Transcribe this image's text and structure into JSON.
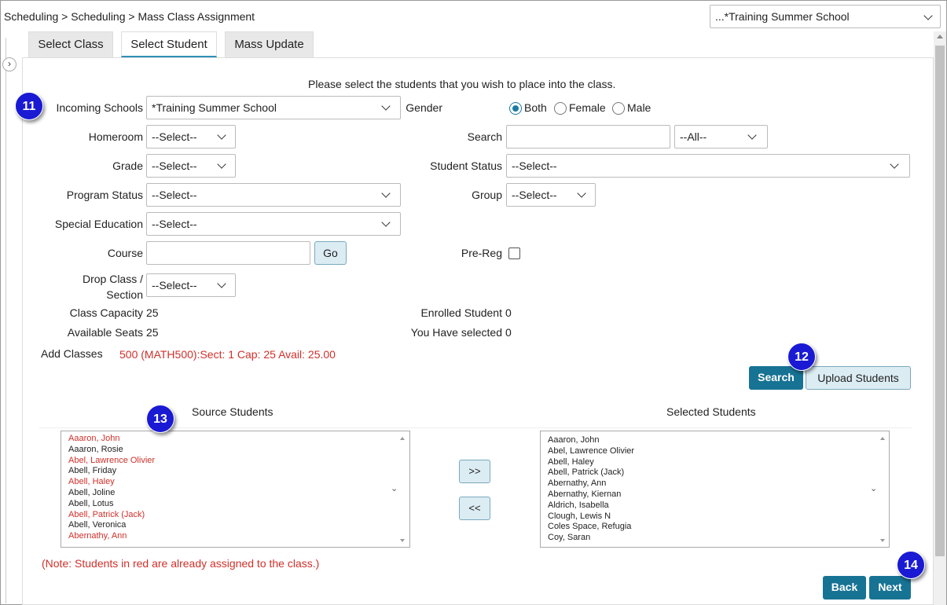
{
  "breadcrumb": "Scheduling > Scheduling > Mass Class Assignment",
  "school_selector": {
    "value": "...*Training Summer School"
  },
  "tabs": [
    {
      "label": "Select Class",
      "active": false
    },
    {
      "label": "Select Student",
      "active": true
    },
    {
      "label": "Mass Update",
      "active": false
    }
  ],
  "instructions": "Please select the students that you wish to place into the class.",
  "filters": {
    "incoming_schools": {
      "label": "Incoming Schools",
      "value": "*Training Summer School"
    },
    "homeroom": {
      "label": "Homeroom",
      "value": "--Select--"
    },
    "grade": {
      "label": "Grade",
      "value": "--Select--"
    },
    "program_status": {
      "label": "Program Status",
      "value": "--Select--"
    },
    "special_education": {
      "label": "Special Education",
      "value": "--Select--"
    },
    "course": {
      "label": "Course",
      "value": "",
      "go_label": "Go"
    },
    "drop_class": {
      "label_line1": "Drop Class /",
      "label_line2": "Section",
      "value": "--Select--"
    },
    "gender": {
      "label": "Gender",
      "options": [
        "Both",
        "Female",
        "Male"
      ],
      "selected": "Both"
    },
    "search": {
      "label": "Search",
      "value": "",
      "scope": "--All--"
    },
    "student_status": {
      "label": "Student Status",
      "value": "--Select--"
    },
    "group": {
      "label": "Group",
      "value": "--Select--"
    },
    "pre_reg": {
      "label": "Pre-Reg",
      "checked": false
    }
  },
  "stats": {
    "class_capacity_label": "Class Capacity",
    "class_capacity": "25",
    "available_seats_label": "Available Seats",
    "available_seats": "25",
    "enrolled_label": "Enrolled Student",
    "enrolled": "0",
    "selected_label": "You Have selected",
    "selected": "0"
  },
  "add_classes": {
    "label": "Add Classes",
    "value": "500 (MATH500):Sect: 1 Cap: 25 Avail: 25.00"
  },
  "actions": {
    "search_label": "Search",
    "upload_label": "Upload Students"
  },
  "source_students": {
    "title": "Source Students",
    "items": [
      {
        "name": "Aaaron, John",
        "assigned": true
      },
      {
        "name": "Aaaron, Rosie",
        "assigned": false
      },
      {
        "name": "Abel, Lawrence Olivier",
        "assigned": true
      },
      {
        "name": "Abell, Friday",
        "assigned": false
      },
      {
        "name": "Abell, Haley",
        "assigned": true
      },
      {
        "name": "Abell, Joline",
        "assigned": false
      },
      {
        "name": "Abell, Lotus",
        "assigned": false
      },
      {
        "name": "Abell, Patrick (Jack)",
        "assigned": true
      },
      {
        "name": "Abell, Veronica",
        "assigned": false
      },
      {
        "name": "Abernathy, Ann",
        "assigned": true
      }
    ]
  },
  "selected_students": {
    "title": "Selected Students",
    "items": [
      "Aaaron, John",
      "Abel, Lawrence Olivier",
      "Abell, Haley",
      "Abell, Patrick (Jack)",
      "Abernathy, Ann",
      "Abernathy, Kiernan",
      "Aldrich, Isabella",
      "Clough, Lewis N",
      "Coles Space, Refugia",
      "Coy, Saran"
    ]
  },
  "move": {
    "add_label": ">>",
    "remove_label": "<<"
  },
  "note": "(Note: Students in red are already assigned to the class.)",
  "nav": {
    "back_label": "Back",
    "next_label": "Next"
  },
  "callouts": {
    "a": "11",
    "b": "12",
    "c": "13",
    "d": "14"
  },
  "colors": {
    "accent": "#177394",
    "assigned_red": "#d0302a",
    "callout": "#1a1ad4"
  }
}
